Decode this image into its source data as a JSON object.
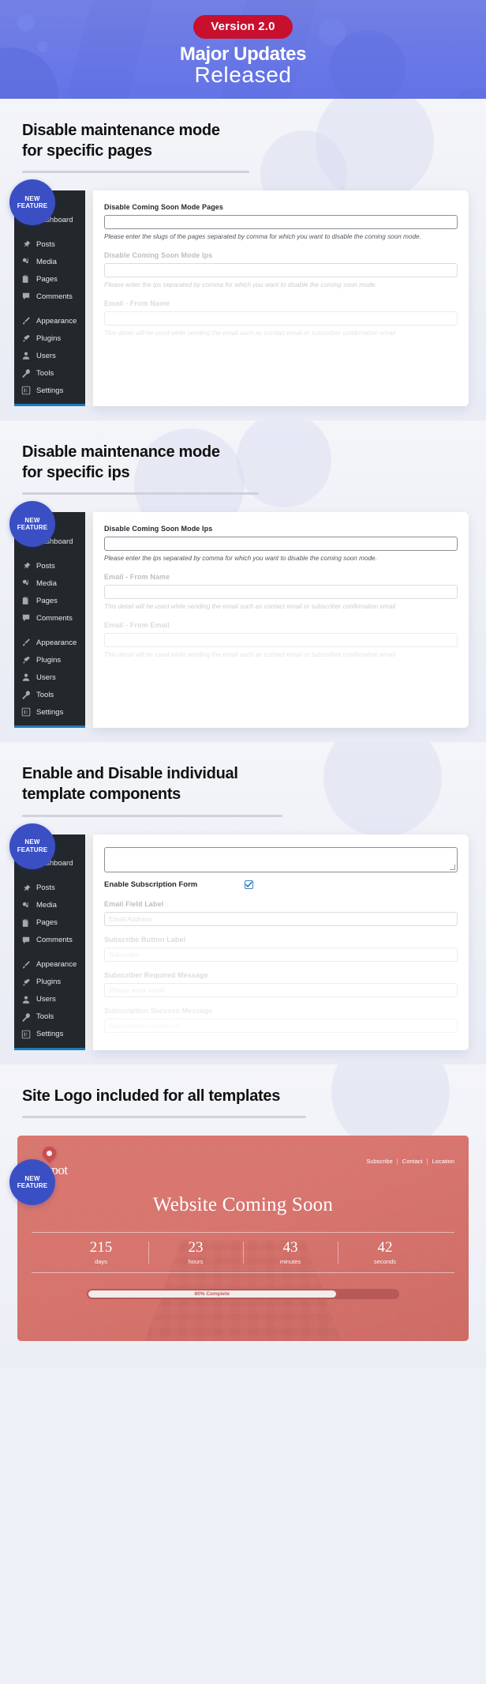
{
  "hero": {
    "version_pill": "Version 2.0",
    "title_line1": "Major Updates",
    "title_line2": "Released"
  },
  "badge": {
    "line1": "NEW",
    "line2": "FEATURE"
  },
  "wp_menu": [
    {
      "label": "Dashboard",
      "icon": "dashboard-icon"
    },
    {
      "label": "Posts",
      "icon": "pin-icon"
    },
    {
      "label": "Media",
      "icon": "media-icon"
    },
    {
      "label": "Pages",
      "icon": "pages-icon"
    },
    {
      "label": "Comments",
      "icon": "comment-icon"
    },
    {
      "label": "Appearance",
      "icon": "brush-icon"
    },
    {
      "label": "Plugins",
      "icon": "plugin-icon"
    },
    {
      "label": "Users",
      "icon": "user-icon"
    },
    {
      "label": "Tools",
      "icon": "wrench-icon"
    },
    {
      "label": "Settings",
      "icon": "settings-icon"
    }
  ],
  "sections": [
    {
      "title_line1": "Disable maintenance mode",
      "title_line2": "for specific pages",
      "fields": [
        {
          "label": "Disable Coming Soon Mode Pages",
          "value": "",
          "help": "Please enter the slugs of the pages separated by comma for which you want to disable the coming soon mode.",
          "fade": "none"
        },
        {
          "label": "Disable Coming Soon Mode Ips",
          "value": "",
          "help": "Please enter the ips separated by comma for which you want to disable the coming soon mode.",
          "fade": "fade-1"
        },
        {
          "label": "Email - From Name",
          "value": "",
          "help": "This detail will be used while sending the email such as contact email or subscriber confirmation email",
          "fade": "fade-2"
        }
      ]
    },
    {
      "title_line1": "Disable maintenance mode",
      "title_line2": "for specific ips",
      "fields": [
        {
          "label": "Disable Coming Soon Mode Ips",
          "value": "",
          "help": "Please enter the ips separated by comma for which you want to disable the coming soon mode.",
          "fade": "none"
        },
        {
          "label": "Email - From Name",
          "value": "",
          "help": "This detail will be used while sending the email such as contact email or subscriber confirmation email",
          "fade": "fade-1"
        },
        {
          "label": "Email - From Email",
          "value": "",
          "help": "This detail will be used while sending the email such as contact email or subscriber confirmation email",
          "fade": "fade-2"
        }
      ]
    },
    {
      "title_line1": "Enable and Disable individual",
      "title_line2": "template components",
      "checkbox": {
        "label": "Enable Subscription Form",
        "checked": true
      },
      "fields": [
        {
          "label": "Email Field Label",
          "value": "Email Address",
          "help": "",
          "fade": "fade-1"
        },
        {
          "label": "Subscribe Button Label",
          "value": "Subscribe",
          "help": "",
          "fade": "fade-2"
        },
        {
          "label": "Subscriber Required Message",
          "value": "Please enter email",
          "help": "",
          "fade": "fade-2"
        },
        {
          "label": "Subscription Success Message",
          "value": "Subscription successful!",
          "help": "",
          "fade": "fade-3"
        }
      ]
    }
  ],
  "logo_section": {
    "title": "Site Logo included for all templates",
    "template": {
      "logo_text": "thespot",
      "nav": [
        "Subscribe",
        "Contact",
        "Location"
      ],
      "heading": "Website Coming Soon",
      "countdown": [
        {
          "value": "215",
          "label": "days"
        },
        {
          "value": "23",
          "label": "hours"
        },
        {
          "value": "43",
          "label": "minutes"
        },
        {
          "value": "42",
          "label": "seconds"
        }
      ],
      "progress_label": "80% Complete",
      "progress_percent": 80
    }
  },
  "colors": {
    "hero_bg": "#6f7fe8",
    "pill": "#c8102e",
    "badge": "#3b4fc4",
    "wp_sidebar": "#23282d",
    "template_bg": "#d9736e",
    "accent_blue": "#3582c4"
  }
}
